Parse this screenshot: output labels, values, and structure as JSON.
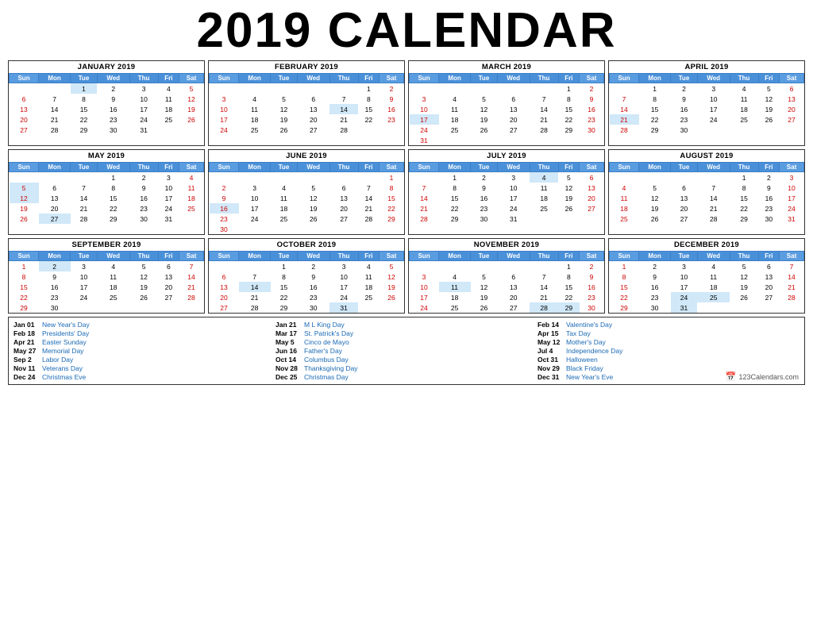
{
  "title": "2019 CALENDAR",
  "months": [
    {
      "name": "JANUARY 2019",
      "weeks": [
        [
          "",
          "",
          "1",
          "2",
          "3",
          "4",
          "5"
        ],
        [
          "6",
          "7",
          "8",
          "9",
          "10",
          "11",
          "12"
        ],
        [
          "13",
          "14",
          "15",
          "16",
          "17",
          "18",
          "19"
        ],
        [
          "20",
          "21",
          "22",
          "23",
          "24",
          "25",
          "26"
        ],
        [
          "27",
          "28",
          "29",
          "30",
          "31",
          "",
          ""
        ]
      ],
      "holidays": [
        1
      ]
    },
    {
      "name": "FEBRUARY 2019",
      "weeks": [
        [
          "",
          "",
          "",
          "",
          "",
          "1",
          "2"
        ],
        [
          "3",
          "4",
          "5",
          "6",
          "7",
          "8",
          "9"
        ],
        [
          "10",
          "11",
          "12",
          "13",
          "14",
          "15",
          "16"
        ],
        [
          "17",
          "18",
          "19",
          "20",
          "21",
          "22",
          "23"
        ],
        [
          "24",
          "25",
          "26",
          "27",
          "28",
          "",
          ""
        ]
      ],
      "holidays": [
        14
      ]
    },
    {
      "name": "MARCH 2019",
      "weeks": [
        [
          "",
          "",
          "",
          "",
          "",
          "1",
          "2"
        ],
        [
          "3",
          "4",
          "5",
          "6",
          "7",
          "8",
          "9"
        ],
        [
          "10",
          "11",
          "12",
          "13",
          "14",
          "15",
          "16"
        ],
        [
          "17",
          "18",
          "19",
          "20",
          "21",
          "22",
          "23"
        ],
        [
          "24",
          "25",
          "26",
          "27",
          "28",
          "29",
          "30"
        ],
        [
          "31",
          "",
          "",
          "",
          "",
          "",
          ""
        ]
      ],
      "holidays": [
        17
      ]
    },
    {
      "name": "APRIL 2019",
      "weeks": [
        [
          "",
          "1",
          "2",
          "3",
          "4",
          "5",
          "6"
        ],
        [
          "7",
          "8",
          "9",
          "10",
          "11",
          "12",
          "13"
        ],
        [
          "14",
          "15",
          "16",
          "17",
          "18",
          "19",
          "20"
        ],
        [
          "21",
          "22",
          "23",
          "24",
          "25",
          "26",
          "27"
        ],
        [
          "28",
          "29",
          "30",
          "",
          "",
          "",
          ""
        ]
      ],
      "holidays": [
        21
      ]
    },
    {
      "name": "MAY 2019",
      "weeks": [
        [
          "",
          "",
          "",
          "1",
          "2",
          "3",
          "4"
        ],
        [
          "5",
          "6",
          "7",
          "8",
          "9",
          "10",
          "11"
        ],
        [
          "12",
          "13",
          "14",
          "15",
          "16",
          "17",
          "18"
        ],
        [
          "19",
          "20",
          "21",
          "22",
          "23",
          "24",
          "25"
        ],
        [
          "26",
          "27",
          "28",
          "29",
          "30",
          "31",
          ""
        ]
      ],
      "holidays": [
        5,
        12,
        27
      ]
    },
    {
      "name": "JUNE 2019",
      "weeks": [
        [
          "",
          "",
          "",
          "",
          "",
          "",
          "1"
        ],
        [
          "2",
          "3",
          "4",
          "5",
          "6",
          "7",
          "8"
        ],
        [
          "9",
          "10",
          "11",
          "12",
          "13",
          "14",
          "15"
        ],
        [
          "16",
          "17",
          "18",
          "19",
          "20",
          "21",
          "22"
        ],
        [
          "23",
          "24",
          "25",
          "26",
          "27",
          "28",
          "29"
        ],
        [
          "30",
          "",
          "",
          "",
          "",
          "",
          ""
        ]
      ],
      "holidays": [
        16
      ]
    },
    {
      "name": "JULY 2019",
      "weeks": [
        [
          "",
          "1",
          "2",
          "3",
          "4",
          "5",
          "6"
        ],
        [
          "7",
          "8",
          "9",
          "10",
          "11",
          "12",
          "13"
        ],
        [
          "14",
          "15",
          "16",
          "17",
          "18",
          "19",
          "20"
        ],
        [
          "21",
          "22",
          "23",
          "24",
          "25",
          "26",
          "27"
        ],
        [
          "28",
          "29",
          "30",
          "31",
          "",
          "",
          ""
        ]
      ],
      "holidays": [
        4
      ]
    },
    {
      "name": "AUGUST 2019",
      "weeks": [
        [
          "",
          "",
          "",
          "",
          "1",
          "2",
          "3"
        ],
        [
          "4",
          "5",
          "6",
          "7",
          "8",
          "9",
          "10"
        ],
        [
          "11",
          "12",
          "13",
          "14",
          "15",
          "16",
          "17"
        ],
        [
          "18",
          "19",
          "20",
          "21",
          "22",
          "23",
          "24"
        ],
        [
          "25",
          "26",
          "27",
          "28",
          "29",
          "30",
          "31"
        ]
      ],
      "holidays": []
    },
    {
      "name": "SEPTEMBER 2019",
      "weeks": [
        [
          "1",
          "2",
          "3",
          "4",
          "5",
          "6",
          "7"
        ],
        [
          "8",
          "9",
          "10",
          "11",
          "12",
          "13",
          "14"
        ],
        [
          "15",
          "16",
          "17",
          "18",
          "19",
          "20",
          "21"
        ],
        [
          "22",
          "23",
          "24",
          "25",
          "26",
          "27",
          "28"
        ],
        [
          "29",
          "30",
          "",
          "",
          "",
          "",
          ""
        ]
      ],
      "holidays": [
        2
      ]
    },
    {
      "name": "OCTOBER 2019",
      "weeks": [
        [
          "",
          "",
          "1",
          "2",
          "3",
          "4",
          "5"
        ],
        [
          "6",
          "7",
          "8",
          "9",
          "10",
          "11",
          "12"
        ],
        [
          "13",
          "14",
          "15",
          "16",
          "17",
          "18",
          "19"
        ],
        [
          "20",
          "21",
          "22",
          "23",
          "24",
          "25",
          "26"
        ],
        [
          "27",
          "28",
          "29",
          "30",
          "31",
          "",
          ""
        ]
      ],
      "holidays": [
        14,
        31
      ]
    },
    {
      "name": "NOVEMBER 2019",
      "weeks": [
        [
          "",
          "",
          "",
          "",
          "",
          "1",
          "2"
        ],
        [
          "3",
          "4",
          "5",
          "6",
          "7",
          "8",
          "9"
        ],
        [
          "10",
          "11",
          "12",
          "13",
          "14",
          "15",
          "16"
        ],
        [
          "17",
          "18",
          "19",
          "20",
          "21",
          "22",
          "23"
        ],
        [
          "24",
          "25",
          "26",
          "27",
          "28",
          "29",
          "30"
        ]
      ],
      "holidays": [
        11,
        28,
        29
      ]
    },
    {
      "name": "DECEMBER 2019",
      "weeks": [
        [
          "1",
          "2",
          "3",
          "4",
          "5",
          "6",
          "7"
        ],
        [
          "8",
          "9",
          "10",
          "11",
          "12",
          "13",
          "14"
        ],
        [
          "15",
          "16",
          "17",
          "18",
          "19",
          "20",
          "21"
        ],
        [
          "22",
          "23",
          "24",
          "25",
          "26",
          "27",
          "28"
        ],
        [
          "29",
          "30",
          "31",
          "",
          "",
          "",
          ""
        ]
      ],
      "holidays": [
        24,
        25,
        31
      ]
    }
  ],
  "days": [
    "Sun",
    "Mon",
    "Tue",
    "Wed",
    "Thu",
    "Fri",
    "Sat"
  ],
  "holidays_col1": [
    {
      "date": "Jan 01",
      "name": "New Year's Day"
    },
    {
      "date": "Feb 18",
      "name": "Presidents' Day"
    },
    {
      "date": "Apr 21",
      "name": "Easter Sunday"
    },
    {
      "date": "May 27",
      "name": "Memorial Day"
    },
    {
      "date": "Sep 2",
      "name": "Labor Day"
    },
    {
      "date": "Nov 11",
      "name": "Veterans Day"
    },
    {
      "date": "Dec 24",
      "name": "Christmas Eve"
    }
  ],
  "holidays_col2": [
    {
      "date": "Jan 21",
      "name": "M L King Day"
    },
    {
      "date": "Mar 17",
      "name": "St. Patrick's Day"
    },
    {
      "date": "May 5",
      "name": "Cinco de Mayo"
    },
    {
      "date": "Jun 16",
      "name": "Father's Day"
    },
    {
      "date": "Oct 14",
      "name": "Columbus Day"
    },
    {
      "date": "Nov 28",
      "name": "Thanksgiving Day"
    },
    {
      "date": "Dec 25",
      "name": "Christmas Day"
    }
  ],
  "holidays_col3": [
    {
      "date": "Feb 14",
      "name": "Valentine's Day"
    },
    {
      "date": "Apr 15",
      "name": "Tax Day"
    },
    {
      "date": "May 12",
      "name": "Mother's Day"
    },
    {
      "date": "Jul 4",
      "name": "Independence Day"
    },
    {
      "date": "Oct 31",
      "name": "Halloween"
    },
    {
      "date": "Nov 29",
      "name": "Black Friday"
    },
    {
      "date": "Dec 31",
      "name": "New Year's Eve"
    }
  ],
  "brand": "123Calendars.com"
}
